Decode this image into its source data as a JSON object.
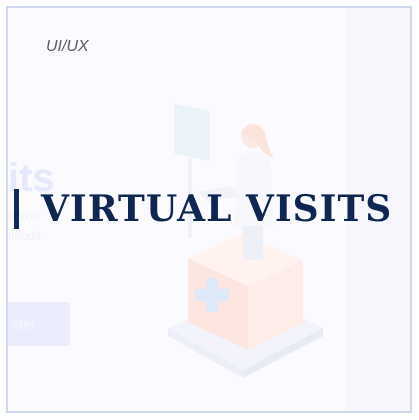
{
  "card": {
    "category": "UI/UX",
    "title": "VIRTUAL VISITS"
  },
  "faded_page": {
    "heading_fragment": "its",
    "line1_fragment": "p you",
    "line2_fragment": "ifficult",
    "button_fragment": "ster"
  },
  "colors": {
    "title": "#0f2653",
    "accent_bar": "#102a57",
    "frame_border": "#cfd8ee",
    "faded_button": "#ebedfd"
  },
  "icons": {
    "illustration": "doctor-at-medical-kiosk-illustration"
  }
}
